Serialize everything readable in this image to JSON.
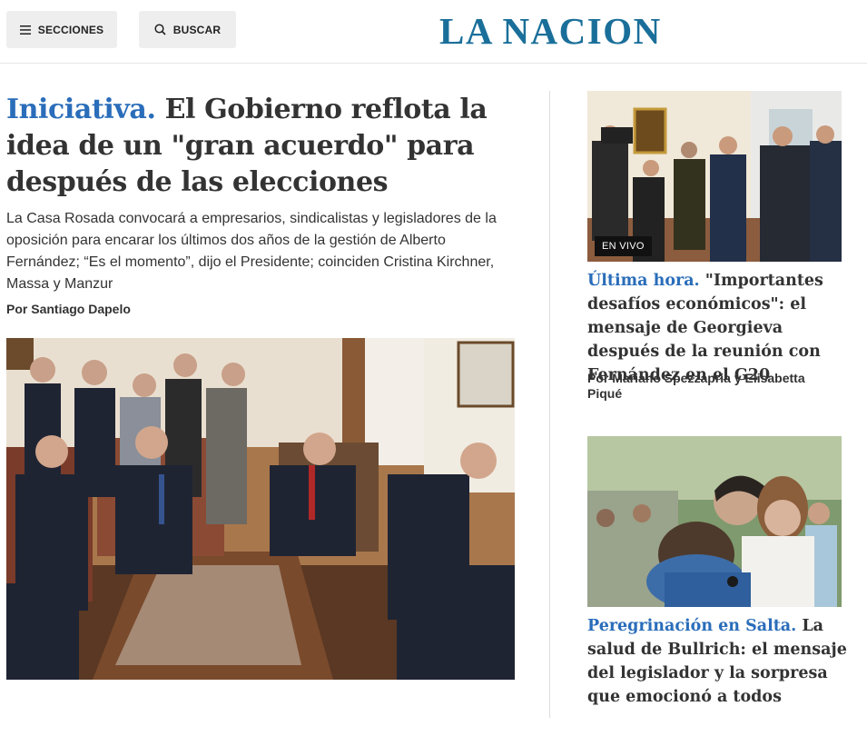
{
  "header": {
    "secciones_label": "SECCIONES",
    "buscar_label": "BUSCAR",
    "logo_text": "LA NACION",
    "logo_color": "#1a6f9a"
  },
  "main_story": {
    "kicker": "Iniciativa.",
    "headline": "El Gobierno reflota la idea de un \"gran acuerdo\" para después de las elecciones",
    "summary": "La Casa Rosada convocará a empresarios, sindicalistas y legisladores de la oposición para encarar los últimos dos años de la gestión de Alberto Fernández; “Es el momento”, dijo el Presidente; coinciden Cristina Kirchner, Massa y Manzur",
    "byline": "Por Santiago Dapelo"
  },
  "side_stories": [
    {
      "badge": "EN VIVO",
      "kicker": "Última hora.",
      "headline": "\"Importantes desafíos económicos\": el mensaje de Georgieva después de la reunión con Fernández en el G20",
      "byline": "Por Mariano Spezzapria y Elisabetta Piqué"
    },
    {
      "kicker": "Peregrinación en Salta.",
      "headline": "La salud de Bullrich: el mensaje del legislador y la sorpresa que emocionó a todos"
    }
  ],
  "colors": {
    "kicker": "#2a6dba",
    "text": "#333333",
    "button_bg": "#eeeeee"
  }
}
